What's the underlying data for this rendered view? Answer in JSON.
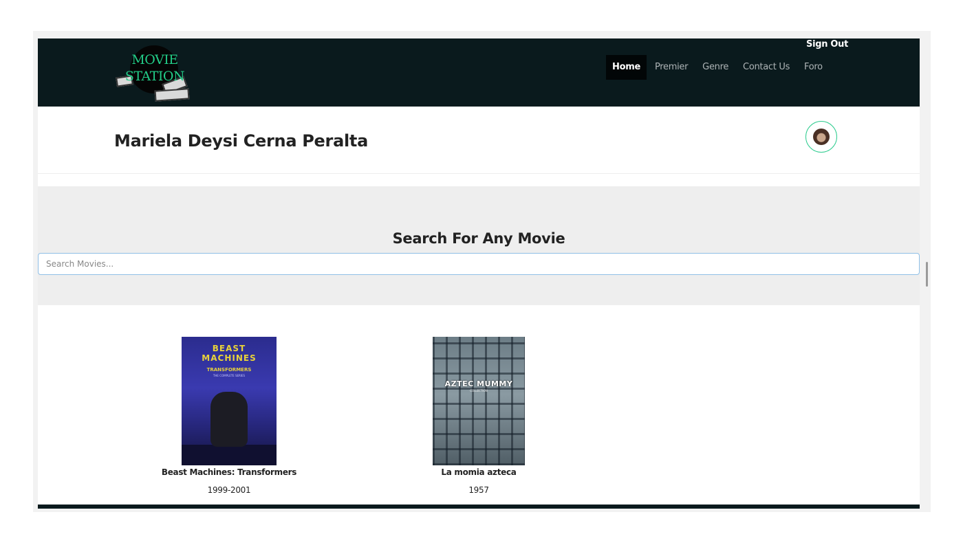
{
  "app": {
    "logo": {
      "line1": "MOVIE",
      "line2": "STATION"
    },
    "header": {
      "sign_out": "Sign Out",
      "nav": [
        "Home",
        "Premier",
        "Genre",
        "Contact Us",
        "Foro"
      ],
      "active_nav": "Home"
    },
    "profile": {
      "name": "Mariela Deysi Cerna Peralta"
    },
    "search": {
      "title": "Search For Any Movie",
      "placeholder": "Search Movies..."
    },
    "movies": [
      {
        "title": "Beast Machines: Transformers",
        "year": "1999-2001",
        "poster_text": [
          "BEAST",
          "MACHINES",
          "TRANSFORMERS",
          "THE COMPLETE SERIES"
        ]
      },
      {
        "title": "La momia azteca",
        "year": "1957",
        "poster_text": [
          "AZTEC MUMMY",
          "COLLECTION"
        ]
      }
    ],
    "colors": {
      "header_bg": "#0a1a1d",
      "logo_text": "#22cc88",
      "search_border": "#8fbfe6",
      "avatar_ring": "#2ecc8f"
    }
  }
}
